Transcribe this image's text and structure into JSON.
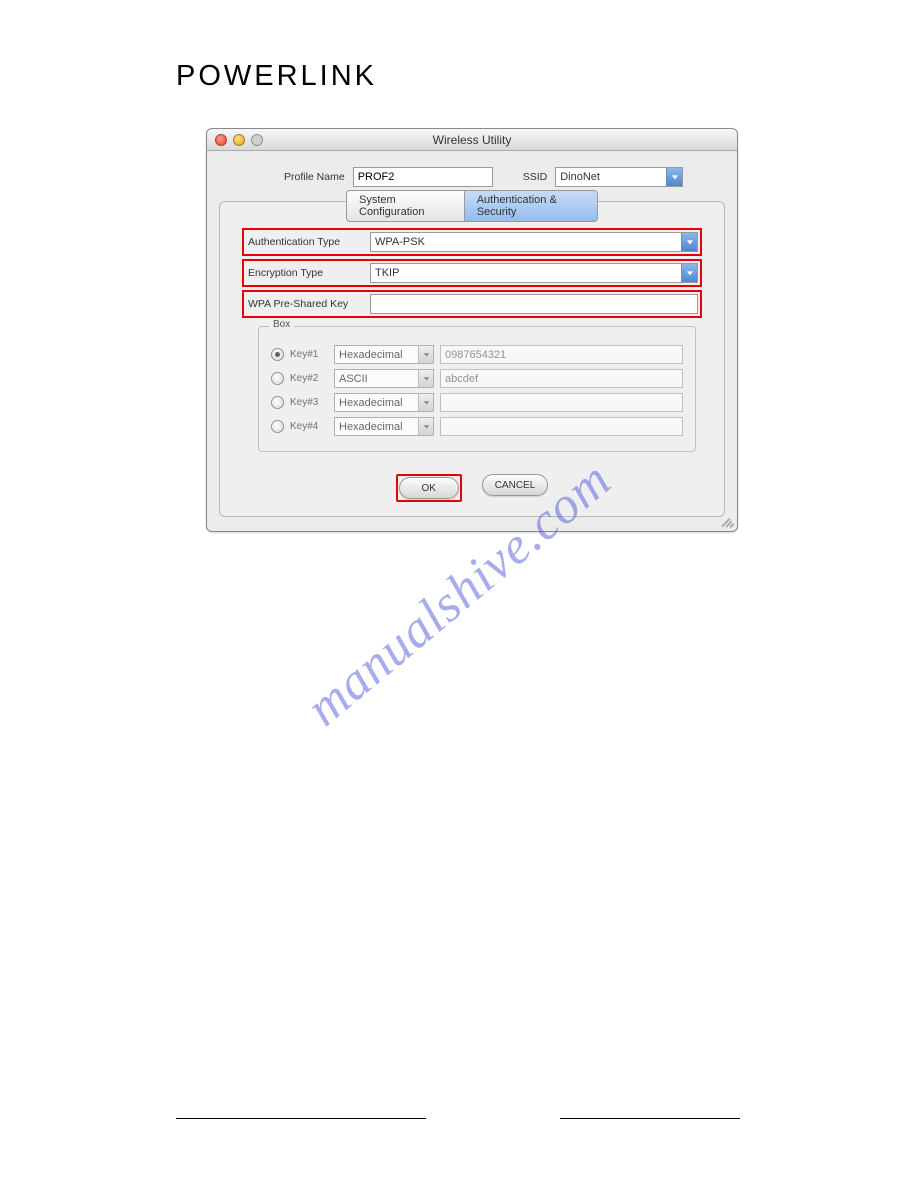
{
  "brand": "POWERLINK",
  "watermark": "manualshive.com",
  "window": {
    "title": "Wireless Utility",
    "profile_name_label": "Profile Name",
    "profile_name_value": "PROF2",
    "ssid_label": "SSID",
    "ssid_value": "DinoNet"
  },
  "tabs": {
    "system_config": "System Configuration",
    "auth_security": "Authentication & Security"
  },
  "fields": {
    "auth_type_label": "Authentication Type",
    "auth_type_value": "WPA-PSK",
    "enc_type_label": "Encryption Type",
    "enc_type_value": "TKIP",
    "psk_label": "WPA Pre-Shared Key",
    "psk_value": ""
  },
  "keybox": {
    "legend": "Box",
    "rows": [
      {
        "label": "Key#1",
        "format": "Hexadecimal",
        "value": "0987654321",
        "checked": true
      },
      {
        "label": "Key#2",
        "format": "ASCII",
        "value": "abcdef",
        "checked": false
      },
      {
        "label": "Key#3",
        "format": "Hexadecimal",
        "value": "",
        "checked": false
      },
      {
        "label": "Key#4",
        "format": "Hexadecimal",
        "value": "",
        "checked": false
      }
    ]
  },
  "buttons": {
    "ok": "OK",
    "cancel": "CANCEL"
  }
}
